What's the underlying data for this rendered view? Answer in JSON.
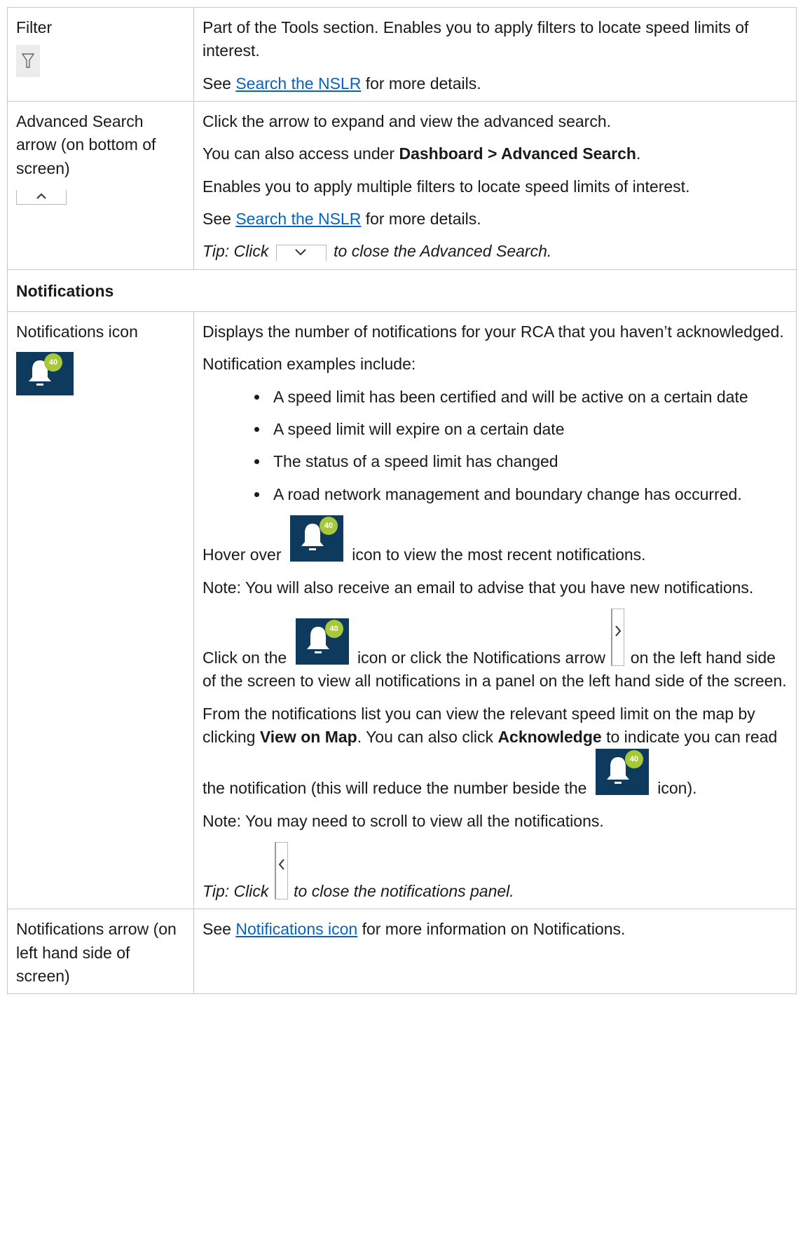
{
  "filter_row": {
    "label": "Filter",
    "icon": "filter-icon",
    "description": "Part of the Tools section. Enables you to apply filters to locate speed limits of interest.",
    "see_prefix": "See ",
    "see_link": "Search the NSLR",
    "see_suffix": " for more details."
  },
  "advanced_row": {
    "label": "Advanced Search arrow (on bottom of screen)",
    "icon": "chevron-up-icon",
    "p1": "Click the arrow to expand and view the advanced search.",
    "p2_prefix": "You can also access under ",
    "p2_bold": "Dashboard > Advanced Search",
    "p2_suffix": ".",
    "p3": "Enables you to apply multiple filters to locate speed limits of interest.",
    "see_prefix": "See ",
    "see_link": "Search the NSLR",
    "see_suffix": " for more details.",
    "tip_prefix": "Tip: Click ",
    "tip_suffix": " to close the Advanced Search."
  },
  "section": {
    "title": "Notifications"
  },
  "notifications_row": {
    "label": "Notifications icon",
    "badge_count": "40",
    "p1": "Displays the number of notifications for your RCA that you haven’t acknowledged.",
    "p2": "Notification examples include:",
    "bullets": [
      "A speed limit has been certified and will be active on a certain date",
      "A speed limit will expire on a certain date",
      "The status of a speed limit has changed",
      "A road network management and boundary change has occurred."
    ],
    "hover_prefix": "Hover over ",
    "hover_suffix": " icon to view the most recent notifications.",
    "note1": "Note: You will also receive an email to advise that you have new notifications.",
    "click_prefix": "Click on the ",
    "click_middle": " icon or click the Notifications arrow ",
    "click_suffix": " on the left hand side of the screen to view all notifications in a panel on the left hand side of the screen.",
    "list_prefix": "From the notifications list you can view the relevant speed limit on the map by clicking ",
    "list_bold1": "View on Map",
    "list_middle": ". You can also click ",
    "list_bold2": "Acknowledge",
    "list_suffix": " to indicate you can read the notification (this will reduce the number beside the ",
    "list_end": " icon).",
    "note2": "Note: You may need to scroll to view all the notifications.",
    "tip_prefix": "Tip: Click ",
    "tip_suffix": " to close the notifications panel."
  },
  "arrow_row": {
    "label": "Notifications arrow (on left hand side of screen)",
    "see_prefix": "See ",
    "see_link": "Notifications icon",
    "see_suffix": " for more information on Notifications."
  },
  "colors": {
    "link": "#0563c1",
    "bell_background": "#0e3a5e",
    "badge": "#a6c83a",
    "border": "#c8c8c8"
  }
}
